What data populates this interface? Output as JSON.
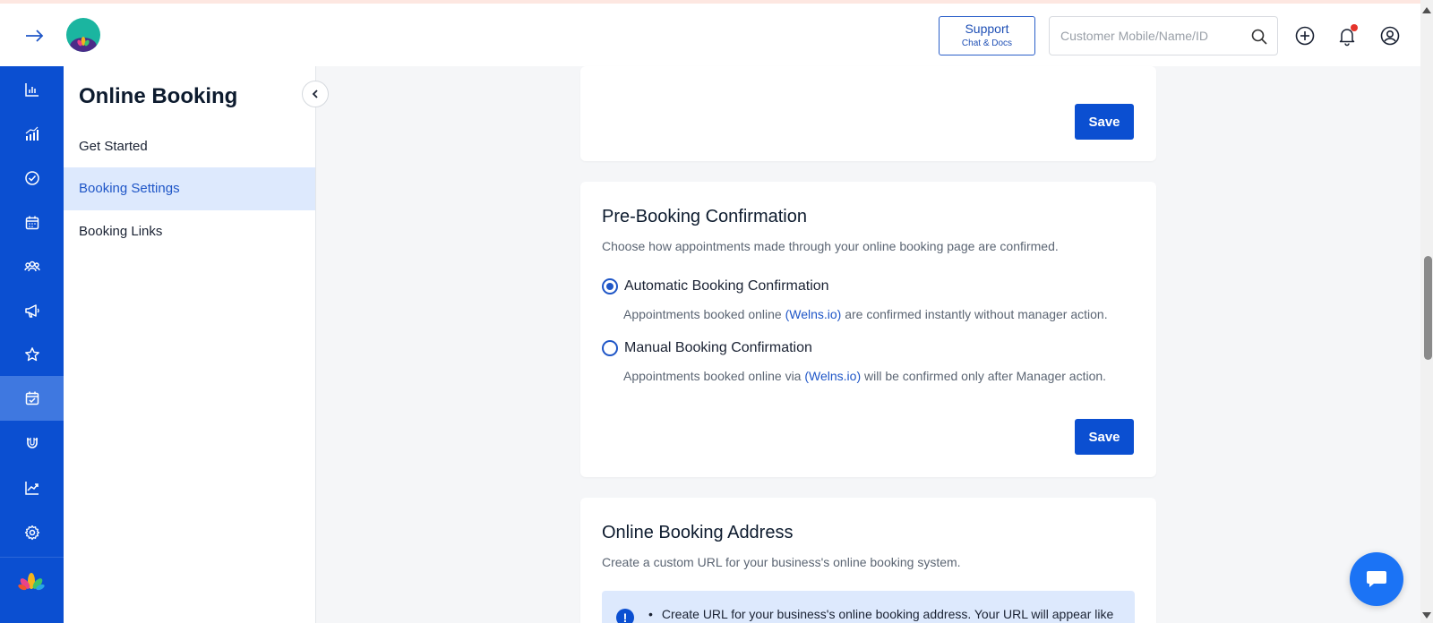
{
  "header": {
    "support_title": "Support",
    "support_subtitle": "Chat & Docs",
    "search_placeholder": "Customer Mobile/Name/ID",
    "icons": [
      "expand-arrow-icon",
      "search-icon",
      "plus-circle-icon",
      "bell-icon",
      "user-circle-icon"
    ]
  },
  "rail": {
    "items": [
      {
        "icon": "bar-chart-icon"
      },
      {
        "icon": "analytics-icon"
      },
      {
        "icon": "check-circle-icon"
      },
      {
        "icon": "calendar-icon"
      },
      {
        "icon": "people-icon"
      },
      {
        "icon": "megaphone-icon"
      },
      {
        "icon": "star-icon"
      },
      {
        "icon": "calendar-check-icon",
        "active": true
      },
      {
        "icon": "magnet-icon"
      },
      {
        "icon": "trend-chart-icon"
      },
      {
        "icon": "gear-icon"
      }
    ],
    "brand_icon": "lotus-logo-icon"
  },
  "subnav": {
    "title": "Online Booking",
    "items": [
      {
        "label": "Get Started"
      },
      {
        "label": "Booking Settings",
        "active": true
      },
      {
        "label": "Booking Links"
      }
    ]
  },
  "cards": {
    "top": {
      "save_label": "Save"
    },
    "pre_booking": {
      "title": "Pre-Booking Confirmation",
      "description": "Choose how appointments made through your online booking page are confirmed.",
      "options": [
        {
          "label": "Automatic Booking Confirmation",
          "help_before": "Appointments booked online ",
          "help_link": "(Welns.io)",
          "help_after": " are confirmed instantly without manager action.",
          "selected": true
        },
        {
          "label": "Manual Booking Confirmation",
          "help_before": "Appointments booked online via ",
          "help_link": "(Welns.io)",
          "help_after": " will be confirmed only after Manager action.",
          "selected": false
        }
      ],
      "save_label": "Save"
    },
    "address": {
      "title": "Online Booking Address",
      "description": "Create a custom URL for your business's online booking system.",
      "info_text": "Create URL for your business's online booking address. Your URL will appear like"
    }
  },
  "colors": {
    "primary": "#0b4fd1",
    "rail_active": "#3f78e0",
    "subnav_active_bg": "#dde9fd",
    "chat_button": "#1b73f5"
  },
  "chat": {
    "icon": "chat-bubble-icon"
  }
}
